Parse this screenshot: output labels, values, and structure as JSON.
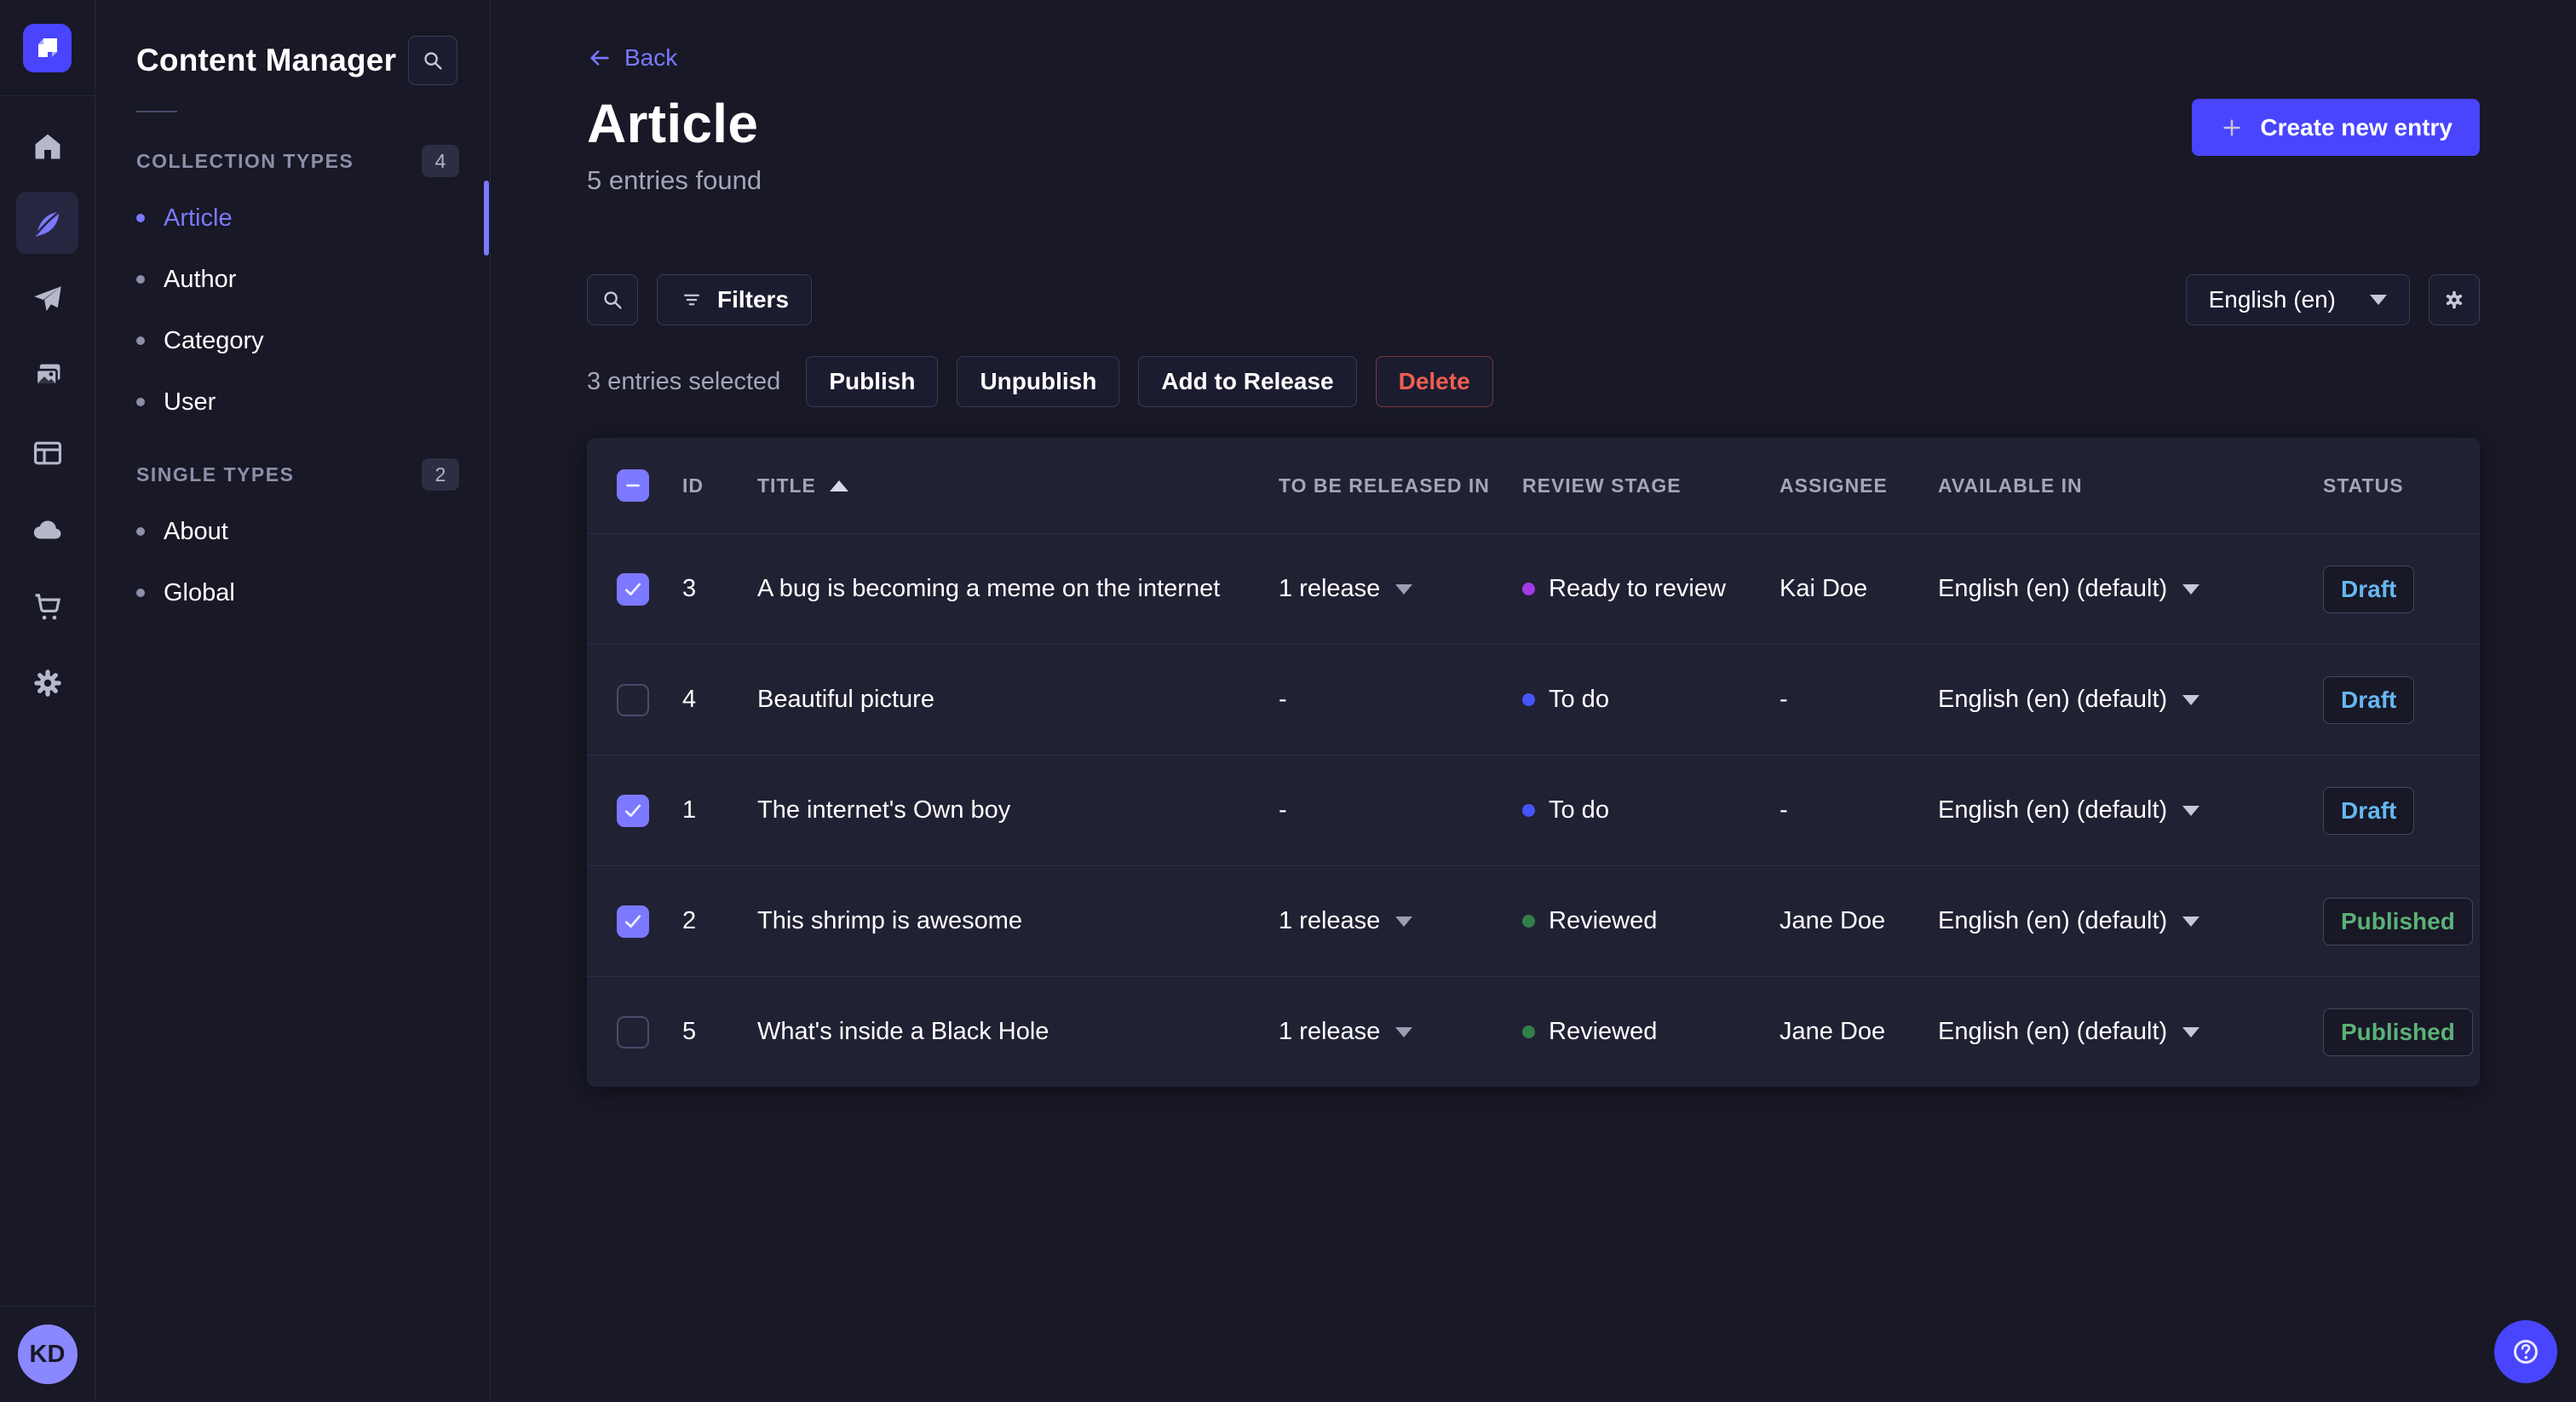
{
  "app": {
    "user_initials": "KD"
  },
  "colors": {
    "background": "#181826",
    "card": "#212134",
    "primary": "#4945ff",
    "primary_light": "#7b79ff",
    "muted_text": "#a5a5ba",
    "draft": "#66b7f1",
    "published": "#5cb176",
    "danger": "#ee5e52",
    "stage_ready": "#a13be6",
    "stage_todo": "#4655fa",
    "stage_reviewed": "#328048"
  },
  "icons": {
    "strapi-logo": "white-folded-square on indigo tile",
    "home-icon": "house",
    "content-manager-icon": "feather (active)",
    "releases-icon": "paper-plane",
    "media-library-icon": "picture-stack",
    "content-type-builder-icon": "layout-card",
    "deploy-icon": "cloud",
    "marketplace-icon": "shopping-cart",
    "settings-icon": "gear",
    "search-icon": "magnifier",
    "filter-icon": "three-decreasing-lines",
    "plus-icon": "+",
    "back-arrow-icon": "←",
    "caret-down-icon": "▾",
    "sort-asc-icon": "▴",
    "check-icon": "✓",
    "dash-icon": "–",
    "help-icon": "circled question mark"
  },
  "subnav": {
    "title": "Content Manager",
    "sections": [
      {
        "label": "COLLECTION TYPES",
        "count": "4",
        "items": [
          {
            "label": "Article",
            "active": true
          },
          {
            "label": "Author",
            "active": false
          },
          {
            "label": "Category",
            "active": false
          },
          {
            "label": "User",
            "active": false
          }
        ]
      },
      {
        "label": "SINGLE TYPES",
        "count": "2",
        "items": [
          {
            "label": "About",
            "active": false
          },
          {
            "label": "Global",
            "active": false
          }
        ]
      }
    ]
  },
  "header": {
    "back_label": "Back",
    "title": "Article",
    "subtitle": "5 entries found",
    "create_button": "Create new entry"
  },
  "toolbar": {
    "filters_label": "Filters",
    "locale_value": "English (en)"
  },
  "selection": {
    "label": "3 entries selected",
    "publish": "Publish",
    "unpublish": "Unpublish",
    "add_to_release": "Add to Release",
    "delete": "Delete"
  },
  "table": {
    "columns": {
      "id": "ID",
      "title": "TITLE",
      "released": "TO BE RELEASED IN",
      "review": "REVIEW STAGE",
      "assignee": "ASSIGNEE",
      "available": "AVAILABLE IN",
      "status": "STATUS"
    },
    "rows": [
      {
        "checked": true,
        "id": "3",
        "title": "A bug is becoming a meme on the internet",
        "released": "1 release",
        "released_caret": true,
        "review": "Ready to review",
        "review_color": "#a13be6",
        "assignee": "Kai Doe",
        "available": "English (en) (default)",
        "status": "Draft",
        "status_color": "#66b7f1"
      },
      {
        "checked": false,
        "id": "4",
        "title": "Beautiful picture",
        "released": "-",
        "released_caret": false,
        "review": "To do",
        "review_color": "#4655fa",
        "assignee": "-",
        "available": "English (en) (default)",
        "status": "Draft",
        "status_color": "#66b7f1"
      },
      {
        "checked": true,
        "id": "1",
        "title": "The internet's Own boy",
        "released": "-",
        "released_caret": false,
        "review": "To do",
        "review_color": "#4655fa",
        "assignee": "-",
        "available": "English (en) (default)",
        "status": "Draft",
        "status_color": "#66b7f1"
      },
      {
        "checked": true,
        "id": "2",
        "title": "This shrimp is awesome",
        "released": "1 release",
        "released_caret": true,
        "review": "Reviewed",
        "review_color": "#328048",
        "assignee": "Jane Doe",
        "available": "English (en) (default)",
        "status": "Published",
        "status_color": "#5cb176"
      },
      {
        "checked": false,
        "id": "5",
        "title": "What's inside a Black Hole",
        "released": "1 release",
        "released_caret": true,
        "review": "Reviewed",
        "review_color": "#328048",
        "assignee": "Jane Doe",
        "available": "English (en) (default)",
        "status": "Published",
        "status_color": "#5cb176"
      }
    ]
  }
}
